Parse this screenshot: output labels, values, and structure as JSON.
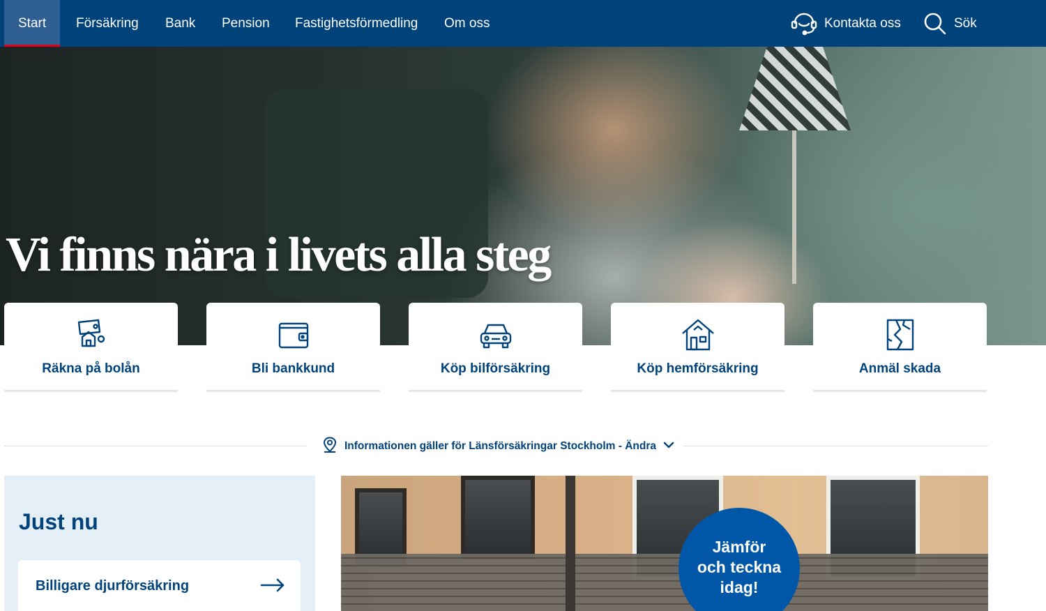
{
  "nav": {
    "items": [
      {
        "label": "Start",
        "active": true
      },
      {
        "label": "Försäkring"
      },
      {
        "label": "Bank"
      },
      {
        "label": "Pension"
      },
      {
        "label": "Fastighetsförmedling"
      },
      {
        "label": "Om oss"
      }
    ],
    "contact_label": "Kontakta oss",
    "contact_icon": "headset-icon",
    "search_label": "Sök",
    "search_icon": "search-icon"
  },
  "hero": {
    "title": "Vi finns nära i livets alla steg"
  },
  "quick_links": [
    {
      "label": "Räkna på bolån",
      "icon": "mortgage-calculator-icon"
    },
    {
      "label": "Bli bankkund",
      "icon": "wallet-icon"
    },
    {
      "label": "Köp bilförsäkring",
      "icon": "car-icon"
    },
    {
      "label": "Köp hemförsäkring",
      "icon": "house-icon"
    },
    {
      "label": "Anmäl skada",
      "icon": "broken-document-icon"
    }
  ],
  "region": {
    "text": "Informationen gäller för Länsförsäkringar Stockholm - Ändra",
    "icon": "location-pin-icon"
  },
  "just_nu": {
    "heading": "Just nu",
    "link_label": "Billigare djurförsäkring"
  },
  "promo": {
    "badge_line1": "Jämför",
    "badge_line2": "och teckna",
    "badge_line3": "idag!"
  },
  "colors": {
    "brand_blue": "#00427a",
    "nav_active": "#2f5e92",
    "active_indicator": "#e2001a",
    "badge_blue": "#0057a8",
    "just_nu_bg": "#e5eff7"
  }
}
